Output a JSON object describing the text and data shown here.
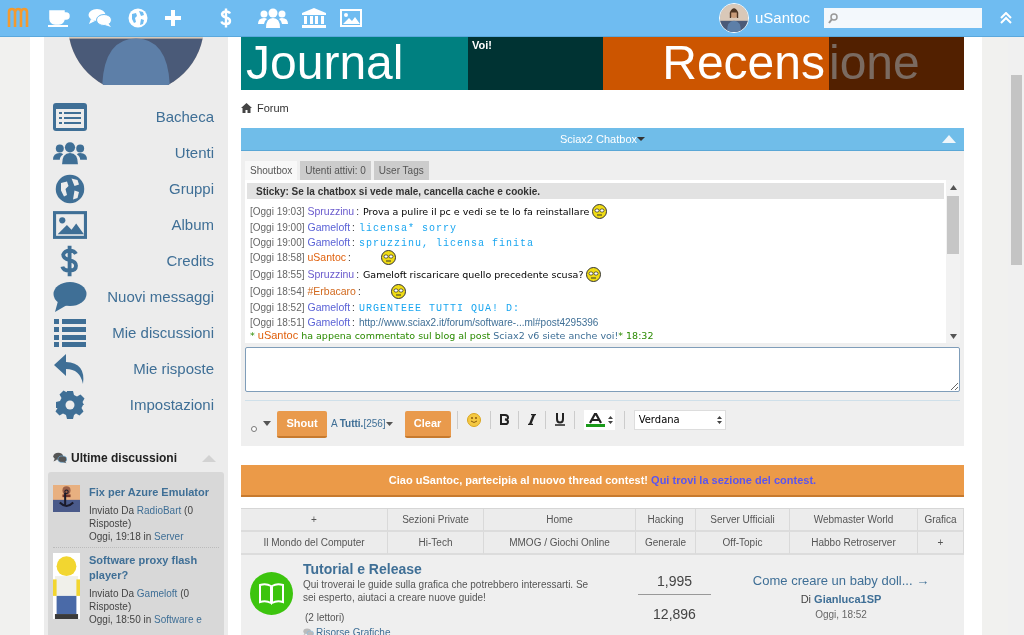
{
  "top_bar": {
    "username": "uSantoc"
  },
  "banner": {
    "tiles": [
      {
        "text": "Journal"
      },
      {
        "text": "Voi!"
      },
      {
        "text": "Recens"
      },
      {
        "text": "ione"
      }
    ]
  },
  "breadcrumb": [
    "Forum"
  ],
  "sidebar": {
    "menu": [
      "Bacheca",
      "Utenti",
      "Gruppi",
      "Album",
      "Credits",
      "Nuovi messaggi",
      "Mie discussioni",
      "Mie risposte",
      "Impostazioni"
    ],
    "latest": {
      "title": "Ultime discussioni",
      "threads": [
        {
          "title": "Fix per Azure Emulator",
          "by": "Inviato Da ",
          "author": "RadioBart",
          "replies": " (0 Risposte)",
          "time": "Oggi, 19:18 in ",
          "forum": "Server"
        },
        {
          "title": "Software proxy flash player?",
          "by": "Inviato Da ",
          "author": "Gameloft",
          "replies": " (0 Risposte)",
          "time": "Oggi, 18:50 in ",
          "forum": "Software e"
        }
      ]
    }
  },
  "chatbox": {
    "title": "Sciax2 Chatbox",
    "tabs": [
      {
        "label": "Shoutbox",
        "selected": true
      },
      {
        "label": "Utenti attivi: 0",
        "selected": false
      },
      {
        "label": "User Tags",
        "selected": false
      }
    ],
    "sticky": "Sticky: Se la chatbox si vede male, cancella cache e cookie.",
    "messages": [
      {
        "kind": "plain",
        "time": "[Oggi 19:03]",
        "user": "Spruzzinu",
        "color": "#6a5acd",
        "separator": ":",
        "text": "Prova a pulire il pc e vedi se te lo fa reinstallare",
        "emoticon": true
      },
      {
        "kind": "mono",
        "time": "[Oggi 19:00]",
        "user": "Gameloft",
        "color": "#5a62d6",
        "separator": ":",
        "text": "licensa* sorry",
        "emoticon": false
      },
      {
        "kind": "mono",
        "time": "[Oggi 19:00]",
        "user": "Gameloft",
        "color": "#5a62d6",
        "separator": ":",
        "text": "spruzzinu, licensa finita",
        "emoticon": false
      },
      {
        "kind": "plain",
        "time": "[Oggi 18:58]",
        "user": "uSantoc",
        "color": "#e0600c",
        "separator": ":",
        "emoticon": true
      },
      {
        "kind": "plain",
        "time": "[Oggi 18:55]",
        "user": "Spruzzinu",
        "color": "#6a5acd",
        "separator": ":",
        "text": "Gameloft riscaricare quello precedente scusa?",
        "emoticon": true
      },
      {
        "kind": "plain",
        "time": "[Oggi 18:54]",
        "user": "#Erbacaro",
        "color": "#d2691e",
        "separator": ":",
        "emoticon": true
      },
      {
        "kind": "mono",
        "time": "[Oggi 18:52]",
        "user": "Gameloft",
        "color": "#5a62d6",
        "separator": ":",
        "text": "URGENTEEE TUTTI QUA! D:",
        "emoticon": false
      },
      {
        "kind": "link",
        "time": "[Oggi 18:51]",
        "user": "Gameloft",
        "color": "#5a62d6",
        "separator": ":",
        "text": "http://www.sciax2.it/forum/software-...ml#post4295396",
        "emoticon": false
      },
      {
        "kind": "activity",
        "prefix": "* ",
        "user": "uSantoc",
        "color": "#e0600c",
        "text": " ha appena commentato sul blog al post ",
        "link": "Sciax2 v6 siete anche voi!",
        "suffix": "* 18:32"
      }
    ],
    "toolbar": {
      "shout": "Shout",
      "target_prefix": "A ",
      "target": "Tutti.",
      "count": " [256]",
      "clear": "Clear",
      "font": "Verdana"
    }
  },
  "notice": {
    "text": "Ciao uSantoc, partecipia al nuovo thread contest! ",
    "link": "Qui trovi la sezione del contest."
  },
  "category_nav": [
    [
      "+",
      "Sezioni Private",
      "Home",
      "Hacking",
      "Server Ufficiali",
      "Webmaster World",
      "Grafica"
    ],
    [
      "Il Mondo del Computer",
      "Hi-Tech",
      "MMOG / Giochi Online",
      "Generale",
      "Off-Topic",
      "Habbo Retroserver",
      "+"
    ]
  ],
  "forums": [
    {
      "title": "Tutorial e Release",
      "description": "Qui troverai le guide sulla grafica che potrebbero interessarti. Se sei esperto, aiutaci a creare nuove guide!",
      "readers": "(2 lettori)",
      "subforum": "Risorse Grafiche",
      "threads": "1,995",
      "posts": "12,896",
      "last_post": "Come creare un baby doll... →",
      "last_by": "Di ",
      "last_author": "Gianluca1SP",
      "last_time": "Oggi, 18:52"
    }
  ]
}
